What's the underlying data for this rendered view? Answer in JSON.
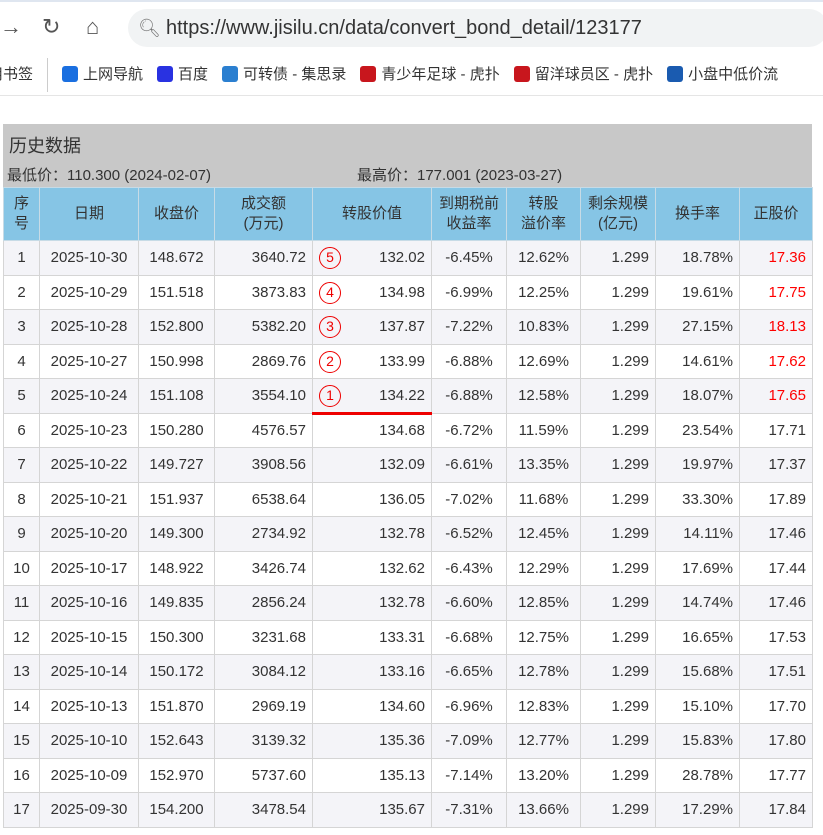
{
  "browser": {
    "url": "https://www.jisilu.cn/data/convert_bond_detail/123177",
    "bookmarks": [
      {
        "label": "用书签",
        "icon": "none"
      },
      {
        "label": "上网导航",
        "icon": "q-icon",
        "color": "#1a6fe0"
      },
      {
        "label": "百度",
        "icon": "paw-icon",
        "color": "#2932e1"
      },
      {
        "label": "可转债 - 集思录",
        "icon": "jisilu-icon",
        "color": "#2b7fd0"
      },
      {
        "label": "青少年足球 - 虎扑",
        "icon": "hupu-icon",
        "color": "#c8161d"
      },
      {
        "label": "留洋球员区 - 虎扑",
        "icon": "hupu-icon",
        "color": "#c8161d"
      },
      {
        "label": "小盘中低价流",
        "icon": "circle-icon",
        "color": "#1a5bb0"
      }
    ]
  },
  "panel": {
    "title": "历史数据",
    "low": "最低价：110.300 (2024-02-07)",
    "high": "最高价：177.001 (2023-03-27)"
  },
  "headers": [
    "序\n号",
    "日期",
    "收盘价",
    "成交额\n(万元)",
    "转股价值",
    "到期税前\n收益率",
    "转股\n溢价率",
    "剩余规模\n(亿元)",
    "换手率",
    "正股价"
  ],
  "rows": [
    [
      "1",
      "2025-10-30",
      "148.672",
      "3640.72",
      "132.02",
      "-6.45%",
      "12.62%",
      "1.299",
      "18.78%",
      "17.36",
      "5"
    ],
    [
      "2",
      "2025-10-29",
      "151.518",
      "3873.83",
      "134.98",
      "-6.99%",
      "12.25%",
      "1.299",
      "19.61%",
      "17.75",
      "4"
    ],
    [
      "3",
      "2025-10-28",
      "152.800",
      "5382.20",
      "137.87",
      "-7.22%",
      "10.83%",
      "1.299",
      "27.15%",
      "18.13",
      "3"
    ],
    [
      "4",
      "2025-10-27",
      "150.998",
      "2869.76",
      "133.99",
      "-6.88%",
      "12.69%",
      "1.299",
      "14.61%",
      "17.62",
      "2"
    ],
    [
      "5",
      "2025-10-24",
      "151.108",
      "3554.10",
      "134.22",
      "-6.88%",
      "12.58%",
      "1.299",
      "18.07%",
      "17.65",
      "1"
    ],
    [
      "6",
      "2025-10-23",
      "150.280",
      "4576.57",
      "134.68",
      "-6.72%",
      "11.59%",
      "1.299",
      "23.54%",
      "17.71",
      ""
    ],
    [
      "7",
      "2025-10-22",
      "149.727",
      "3908.56",
      "132.09",
      "-6.61%",
      "13.35%",
      "1.299",
      "19.97%",
      "17.37",
      ""
    ],
    [
      "8",
      "2025-10-21",
      "151.937",
      "6538.64",
      "136.05",
      "-7.02%",
      "11.68%",
      "1.299",
      "33.30%",
      "17.89",
      ""
    ],
    [
      "9",
      "2025-10-20",
      "149.300",
      "2734.92",
      "132.78",
      "-6.52%",
      "12.45%",
      "1.299",
      "14.11%",
      "17.46",
      ""
    ],
    [
      "10",
      "2025-10-17",
      "148.922",
      "3426.74",
      "132.62",
      "-6.43%",
      "12.29%",
      "1.299",
      "17.69%",
      "17.44",
      ""
    ],
    [
      "11",
      "2025-10-16",
      "149.835",
      "2856.24",
      "132.78",
      "-6.60%",
      "12.85%",
      "1.299",
      "14.74%",
      "17.46",
      ""
    ],
    [
      "12",
      "2025-10-15",
      "150.300",
      "3231.68",
      "133.31",
      "-6.68%",
      "12.75%",
      "1.299",
      "16.65%",
      "17.53",
      ""
    ],
    [
      "13",
      "2025-10-14",
      "150.172",
      "3084.12",
      "133.16",
      "-6.65%",
      "12.78%",
      "1.299",
      "15.68%",
      "17.51",
      ""
    ],
    [
      "14",
      "2025-10-13",
      "151.870",
      "2969.19",
      "134.60",
      "-6.96%",
      "12.83%",
      "1.299",
      "15.10%",
      "17.70",
      ""
    ],
    [
      "15",
      "2025-10-10",
      "152.643",
      "3139.32",
      "135.36",
      "-7.09%",
      "12.77%",
      "1.299",
      "15.83%",
      "17.80",
      ""
    ],
    [
      "16",
      "2025-10-09",
      "152.970",
      "5737.60",
      "135.13",
      "-7.14%",
      "13.20%",
      "1.299",
      "28.78%",
      "17.77",
      ""
    ],
    [
      "17",
      "2025-09-30",
      "154.200",
      "3478.54",
      "135.67",
      "-7.31%",
      "13.66%",
      "1.299",
      "17.29%",
      "17.84",
      ""
    ]
  ]
}
